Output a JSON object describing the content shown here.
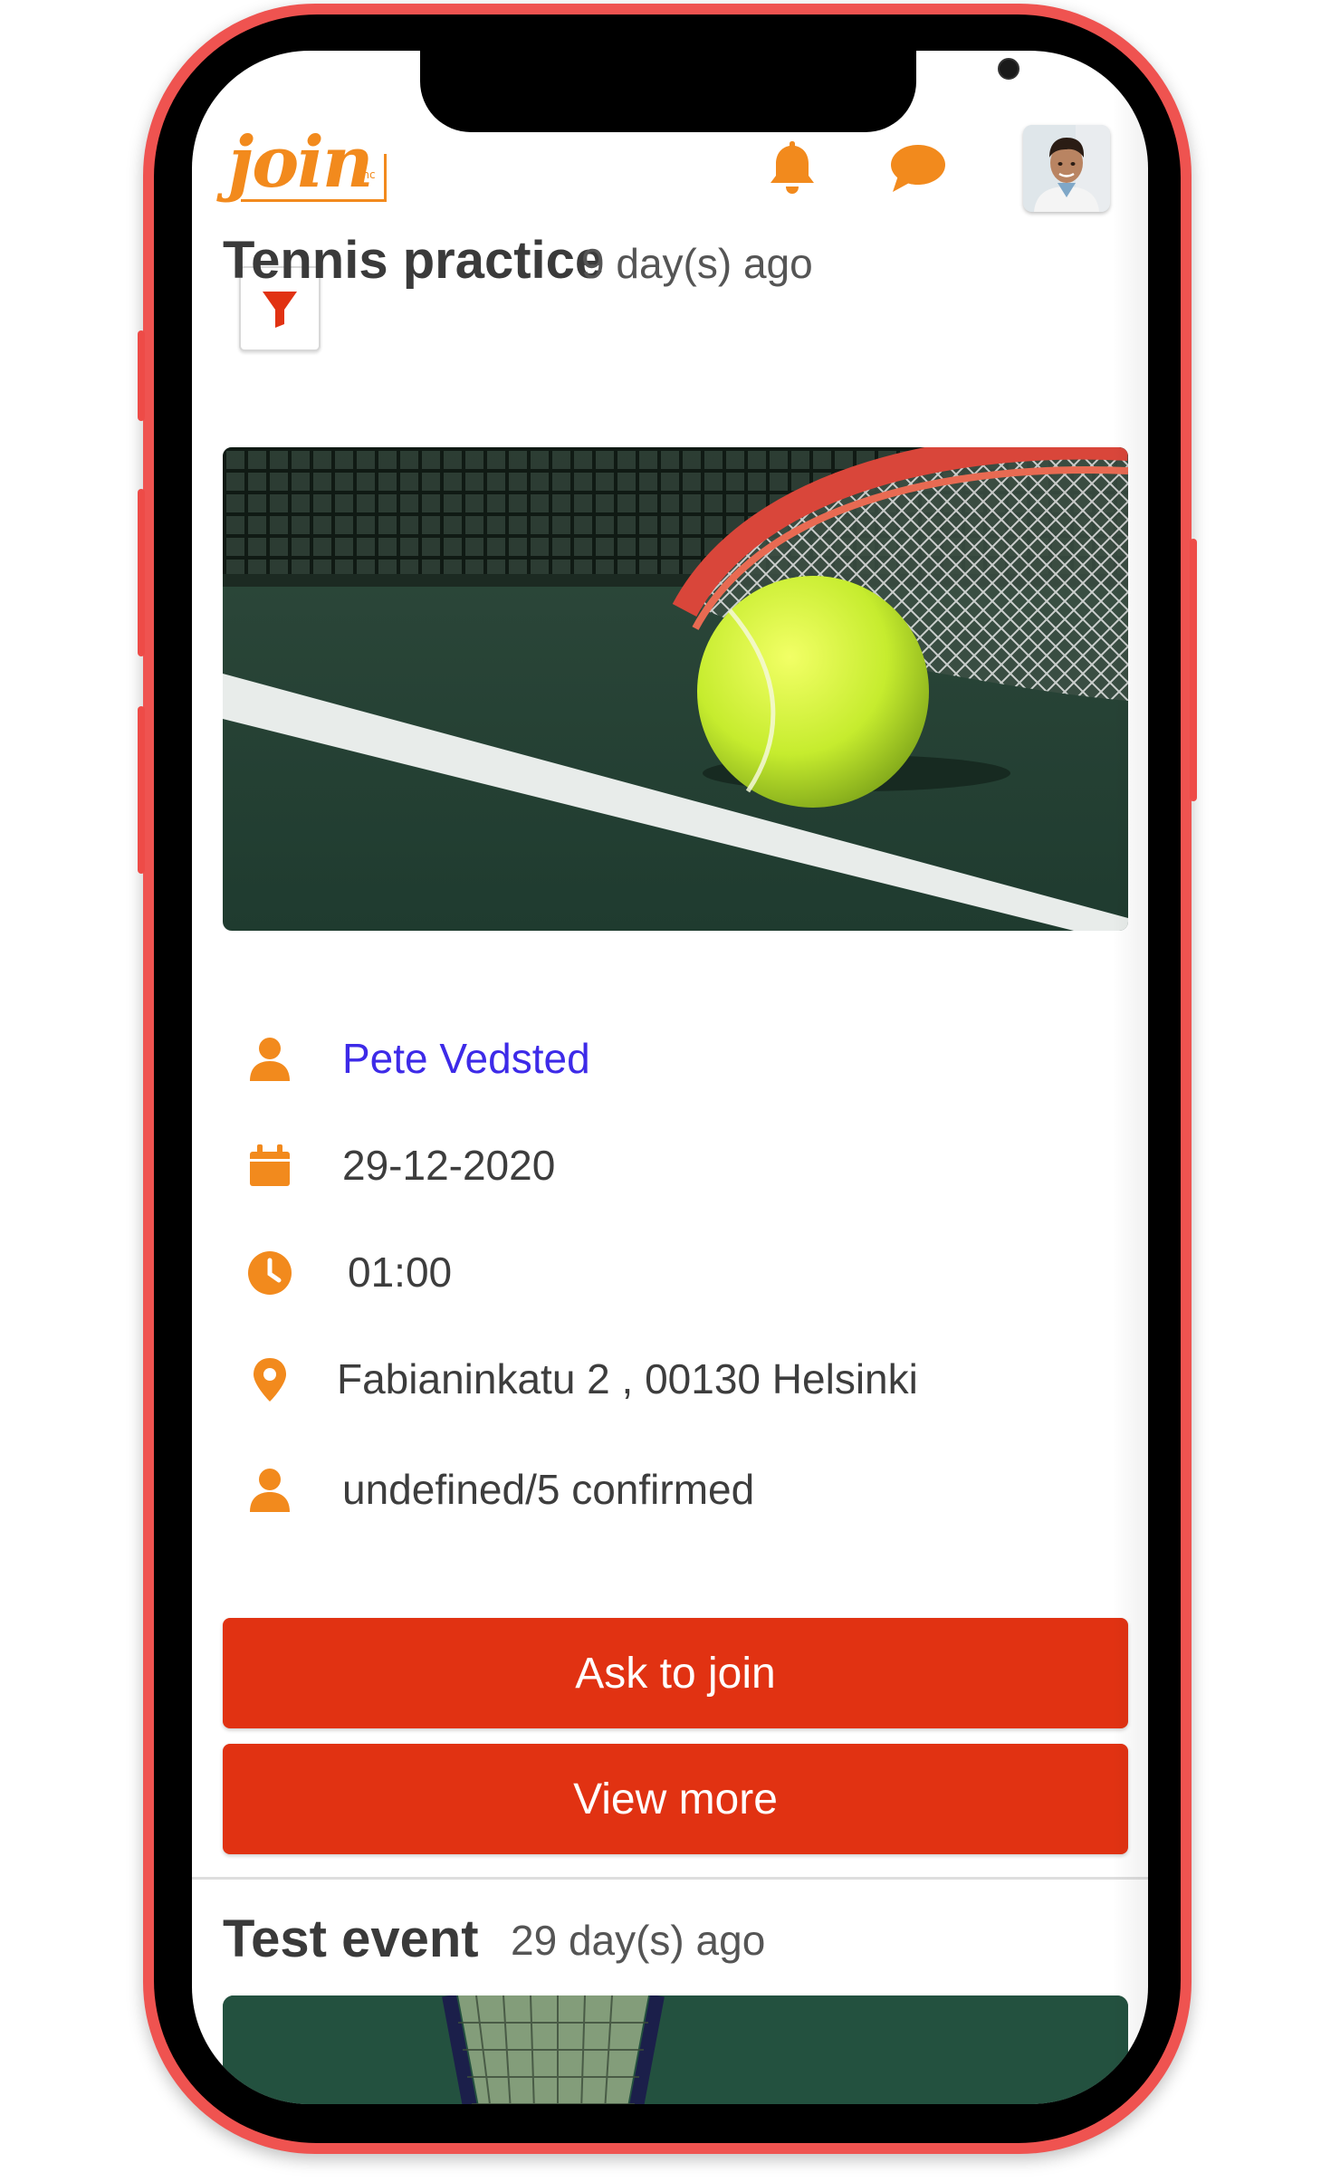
{
  "header": {
    "logo_text": "join",
    "logo_suffix": "inc",
    "icons": [
      "bell-icon",
      "chat-icon"
    ],
    "avatar": "user-avatar"
  },
  "filter": {
    "icon": "filter-icon"
  },
  "events": [
    {
      "title": "Tennis practice",
      "ago": "9 day(s) ago",
      "organizer": "Pete Vedsted",
      "date": "29-12-2020",
      "time": "01:00",
      "location": "Fabianinkatu 2 , 00130 Helsinki",
      "participants": "undefined/5 confirmed",
      "buttons": {
        "ask": "Ask to join",
        "view": "View more"
      }
    },
    {
      "title": "Test event",
      "ago": "29 day(s) ago"
    }
  ],
  "colors": {
    "accent": "#f28a1d",
    "button": "#e13212",
    "link": "#3d2ae8",
    "frame": "#ef5350"
  }
}
